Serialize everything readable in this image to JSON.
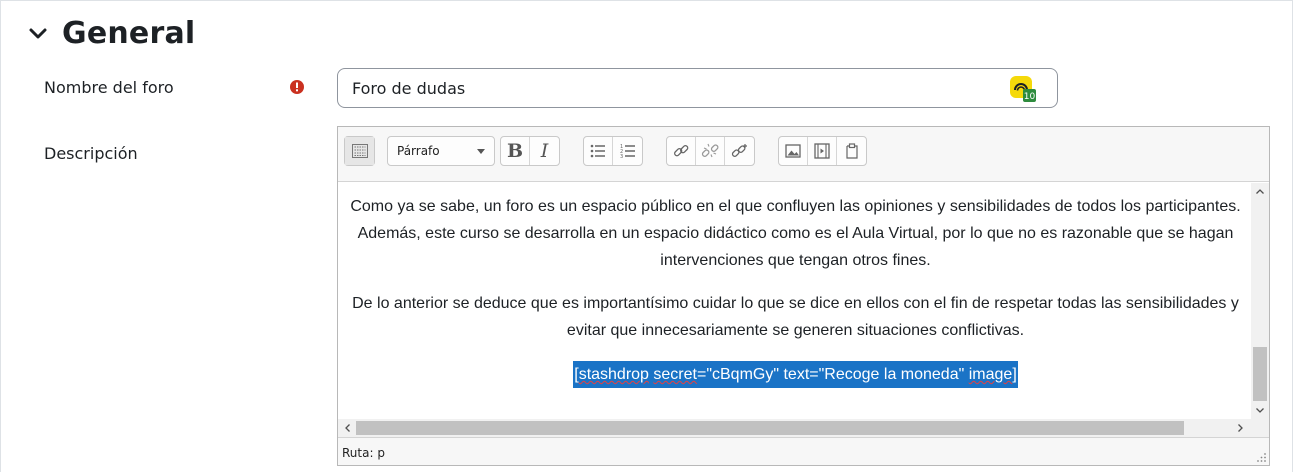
{
  "section": {
    "title": "General"
  },
  "fields": {
    "forum_name": {
      "label": "Nombre del foro",
      "value": "Foro de dudas"
    },
    "description": {
      "label": "Descripción"
    }
  },
  "editor": {
    "format_select": "Párrafo",
    "toolbar": {
      "bold": "B",
      "italic": "I"
    },
    "paragraph1": "Como ya se sabe, un foro es un espacio público en el que confluyen las opiniones y sensibilidades de todos los participantes. Además, este curso se desarrolla en un espacio didáctico como es el Aula Virtual, por lo que no es razonable que se hagan intervenciones que tengan otros fines.",
    "paragraph2": "De lo anterior se deduce que es importantísimo cuidar lo que se dice en ellos con el fin de respetar todas las sensibilidades y evitar que innecesariamente se generen situaciones conflictivas.",
    "shortcode": {
      "open": "[",
      "w1": "stashdrop",
      "w2": "secret",
      "w3": "=\"cBqmGy\" text=\"Recoge la moneda\" ",
      "w4": "image",
      "close": "]"
    },
    "status_path": "Ruta: p"
  },
  "badge": {
    "count": "10"
  },
  "colors": {
    "required": "#ca3120",
    "selection": "#1a73c6",
    "badge_yellow": "#f5d90a",
    "badge_green": "#2e8b3e"
  }
}
